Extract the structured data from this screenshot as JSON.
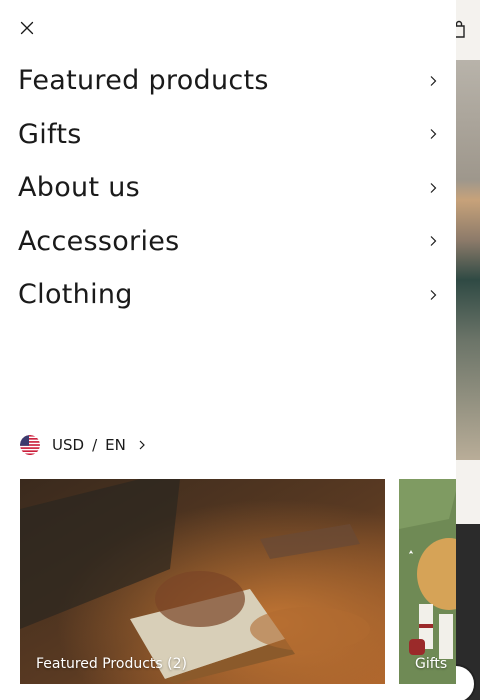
{
  "menu": {
    "close_icon": "close-icon",
    "items": [
      {
        "label": "Featured products"
      },
      {
        "label": "Gifts"
      },
      {
        "label": "About us"
      },
      {
        "label": "Accessories"
      },
      {
        "label": "Clothing"
      }
    ]
  },
  "locale": {
    "flag_icon": "us-flag-icon",
    "currency": "USD",
    "separator": "/",
    "language": "EN"
  },
  "cards": [
    {
      "label": "Featured Products (2)"
    },
    {
      "label": "Gifts"
    }
  ],
  "colors": {
    "text": "#1a1a1a",
    "drawer_bg": "#ffffff",
    "card_label": "#ffffff"
  }
}
